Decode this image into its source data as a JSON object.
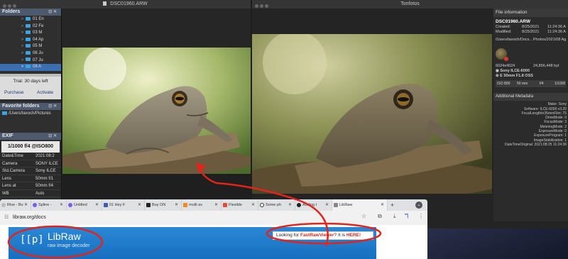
{
  "left_window": {
    "title": "DSC01960.ARW",
    "folders_panel": {
      "title": "Folders",
      "items": [
        "01 En",
        "02 Fe",
        "03 M",
        "04 Ap",
        "05 M",
        "06 Ju",
        "07 Ju",
        "08 A"
      ]
    },
    "trial": {
      "text": "Trial: 30 days left",
      "purchase_label": "Purchase",
      "activate_label": "Activate"
    },
    "favorites_panel": {
      "title": "Favorite folders",
      "items": [
        "/Users/laxoch/Pictures"
      ]
    },
    "exif_panel": {
      "title": "EXIF",
      "summary": "1/1000 f/4 @ISO800",
      "rows": [
        {
          "label": "Date&Time",
          "value": "2021:08:2"
        },
        {
          "label": "Camera",
          "value": "SONY ILCE"
        },
        {
          "label": "Std.Camera",
          "value": "Sony ILCE"
        },
        {
          "label": "Lens",
          "value": "50mm f/1"
        },
        {
          "label": "Lens at",
          "value": "50mm f/4"
        },
        {
          "label": "WB",
          "value": "Auto"
        }
      ]
    }
  },
  "right_window": {
    "title": "Tonfotos",
    "file_info": {
      "header": "File information",
      "filename": "DSC01960.ARW",
      "created_label": "Created:",
      "created_date": "8/25/2021",
      "created_time": "11:24:36 A",
      "modified_label": "Modified:",
      "modified_date": "8/25/2021",
      "modified_time": "11:24:36 A",
      "path": "/Users/laxoch/Docs…Photos/2021/08 Ag",
      "dimensions": "6024x4024",
      "size": "24,856,448 byt",
      "camera": "Sony ILCE-6000",
      "lens": "E 50mm F1.8 OSS",
      "iso": "ISO 800",
      "focal": "50 mm",
      "aperture": "f/4",
      "shutter": "1/1000"
    },
    "additional_metadata": {
      "header": "Additional Metadata",
      "rows": [
        "Make: Sony",
        "Software: ILCE-6000 v3.20",
        "FocalLengthIn35mmFilm: 75",
        "DriveMode: 0",
        "FocusMode: 3",
        "MeteringMode: 2",
        "ExposureMode: 0",
        "ExposureProgram: 1",
        "ImageStabilization: 1",
        "DateTimeOriginal: 2021:08:25 11:24:36"
      ]
    }
  },
  "browser": {
    "tabs": [
      "Rive - Bu",
      "Spline -",
      "Untitled",
      "01 Hey F",
      "Buy ON",
      "multi av",
      "Flexible",
      "Some ph",
      "Adding t",
      "LibRaw"
    ],
    "url": "libraw.org/docs",
    "page": {
      "logo_mark": "[[p]",
      "logo_title": "LibRaw",
      "logo_subtitle": "raw image decoder",
      "banner_prefix": "Looking for ",
      "banner_link": "FastRawViewer",
      "banner_mid": "? It is ",
      "banner_here": "HERE!"
    }
  },
  "colors": {
    "annotation_red": "#e3241b",
    "accent_blue": "#3ba3e0",
    "libraw_header": "#1a75c4"
  }
}
